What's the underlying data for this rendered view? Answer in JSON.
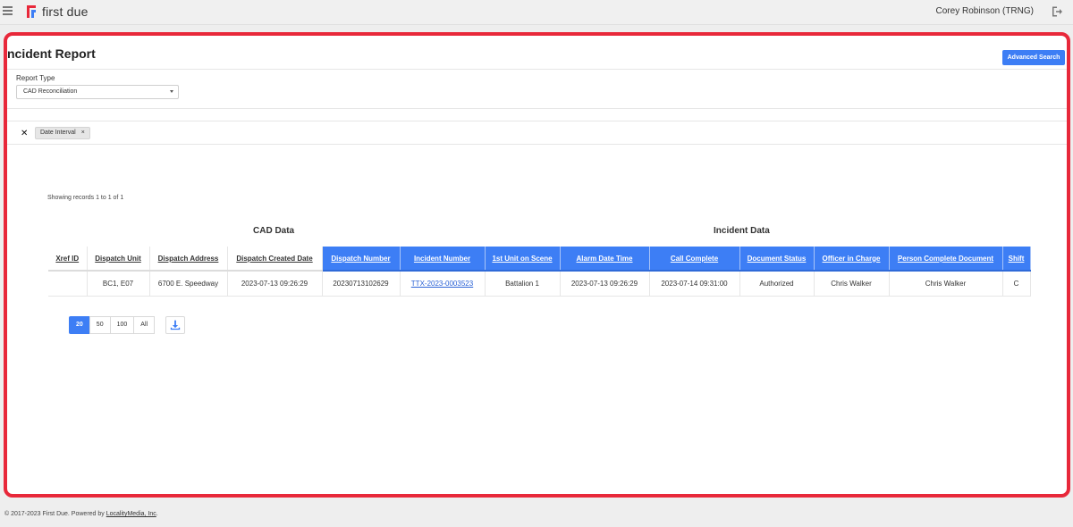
{
  "header": {
    "app_name": "first due",
    "user_name": "Corey Robinson (TRNG)",
    "brand_color": "#e8283a",
    "brand_color_2": "#3d7ef5"
  },
  "page": {
    "title": "ncident Report",
    "advanced_search_label": "Advanced Search",
    "report_type_label": "Report Type",
    "report_type_value": "CAD Reconciliation",
    "filter_chip_label": "Date Interval",
    "records_text": "Showing records 1 to 1 of 1"
  },
  "table": {
    "group_cad": "CAD Data",
    "group_incident": "Incident Data",
    "columns": [
      {
        "label": "Xref ID",
        "group": "cad"
      },
      {
        "label": "Dispatch Unit",
        "group": "cad"
      },
      {
        "label": "Dispatch Address",
        "group": "cad"
      },
      {
        "label": "Dispatch Created Date",
        "group": "cad"
      },
      {
        "label": "Dispatch Number",
        "group": "incident"
      },
      {
        "label": "Incident Number",
        "group": "incident"
      },
      {
        "label": "1st Unit on Scene",
        "group": "incident"
      },
      {
        "label": "Alarm Date Time",
        "group": "incident"
      },
      {
        "label": "Call Complete",
        "group": "incident"
      },
      {
        "label": "Document Status",
        "group": "incident"
      },
      {
        "label": "Officer in Charge",
        "group": "incident"
      },
      {
        "label": "Person Complete Document",
        "group": "incident"
      },
      {
        "label": "Shift",
        "group": "incident"
      }
    ],
    "rows": [
      [
        "",
        "BC1, E07",
        "6700 E. Speedway",
        "2023-07-13 09:26:29",
        "20230713102629",
        "TTX-2023-0003523",
        "Battalion 1",
        "2023-07-13 09:26:29",
        "2023-07-14 09:31:00",
        "Authorized",
        "Chris Walker",
        "Chris Walker",
        "C"
      ]
    ]
  },
  "pagination": {
    "sizes": [
      "20",
      "50",
      "100",
      "All"
    ],
    "active": "20"
  },
  "footer": {
    "text": "© 2017-2023 First Due. Powered by ",
    "link": "LocalityMedia, Inc",
    "suffix": "."
  }
}
